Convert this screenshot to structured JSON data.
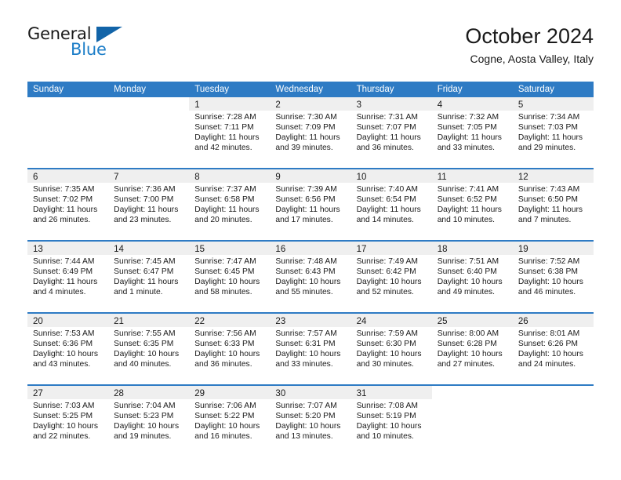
{
  "brand": {
    "name_top": "General",
    "name_bottom": "Blue",
    "triangle_color": "#1264a8",
    "blue_color": "#1d7ec8"
  },
  "header": {
    "title": "October 2024",
    "subtitle": "Cogne, Aosta Valley, Italy"
  },
  "theme": {
    "header_blue": "#2e7bc4",
    "daynum_band": "#efefef",
    "text": "#1a1a1a"
  },
  "weekdays": [
    "Sunday",
    "Monday",
    "Tuesday",
    "Wednesday",
    "Thursday",
    "Friday",
    "Saturday"
  ],
  "weeks": [
    [
      {
        "day": "",
        "sunrise": "",
        "sunset": "",
        "daylight_1": "",
        "daylight_2": ""
      },
      {
        "day": "",
        "sunrise": "",
        "sunset": "",
        "daylight_1": "",
        "daylight_2": ""
      },
      {
        "day": "1",
        "sunrise": "Sunrise: 7:28 AM",
        "sunset": "Sunset: 7:11 PM",
        "daylight_1": "Daylight: 11 hours",
        "daylight_2": "and 42 minutes."
      },
      {
        "day": "2",
        "sunrise": "Sunrise: 7:30 AM",
        "sunset": "Sunset: 7:09 PM",
        "daylight_1": "Daylight: 11 hours",
        "daylight_2": "and 39 minutes."
      },
      {
        "day": "3",
        "sunrise": "Sunrise: 7:31 AM",
        "sunset": "Sunset: 7:07 PM",
        "daylight_1": "Daylight: 11 hours",
        "daylight_2": "and 36 minutes."
      },
      {
        "day": "4",
        "sunrise": "Sunrise: 7:32 AM",
        "sunset": "Sunset: 7:05 PM",
        "daylight_1": "Daylight: 11 hours",
        "daylight_2": "and 33 minutes."
      },
      {
        "day": "5",
        "sunrise": "Sunrise: 7:34 AM",
        "sunset": "Sunset: 7:03 PM",
        "daylight_1": "Daylight: 11 hours",
        "daylight_2": "and 29 minutes."
      }
    ],
    [
      {
        "day": "6",
        "sunrise": "Sunrise: 7:35 AM",
        "sunset": "Sunset: 7:02 PM",
        "daylight_1": "Daylight: 11 hours",
        "daylight_2": "and 26 minutes."
      },
      {
        "day": "7",
        "sunrise": "Sunrise: 7:36 AM",
        "sunset": "Sunset: 7:00 PM",
        "daylight_1": "Daylight: 11 hours",
        "daylight_2": "and 23 minutes."
      },
      {
        "day": "8",
        "sunrise": "Sunrise: 7:37 AM",
        "sunset": "Sunset: 6:58 PM",
        "daylight_1": "Daylight: 11 hours",
        "daylight_2": "and 20 minutes."
      },
      {
        "day": "9",
        "sunrise": "Sunrise: 7:39 AM",
        "sunset": "Sunset: 6:56 PM",
        "daylight_1": "Daylight: 11 hours",
        "daylight_2": "and 17 minutes."
      },
      {
        "day": "10",
        "sunrise": "Sunrise: 7:40 AM",
        "sunset": "Sunset: 6:54 PM",
        "daylight_1": "Daylight: 11 hours",
        "daylight_2": "and 14 minutes."
      },
      {
        "day": "11",
        "sunrise": "Sunrise: 7:41 AM",
        "sunset": "Sunset: 6:52 PM",
        "daylight_1": "Daylight: 11 hours",
        "daylight_2": "and 10 minutes."
      },
      {
        "day": "12",
        "sunrise": "Sunrise: 7:43 AM",
        "sunset": "Sunset: 6:50 PM",
        "daylight_1": "Daylight: 11 hours",
        "daylight_2": "and 7 minutes."
      }
    ],
    [
      {
        "day": "13",
        "sunrise": "Sunrise: 7:44 AM",
        "sunset": "Sunset: 6:49 PM",
        "daylight_1": "Daylight: 11 hours",
        "daylight_2": "and 4 minutes."
      },
      {
        "day": "14",
        "sunrise": "Sunrise: 7:45 AM",
        "sunset": "Sunset: 6:47 PM",
        "daylight_1": "Daylight: 11 hours",
        "daylight_2": "and 1 minute."
      },
      {
        "day": "15",
        "sunrise": "Sunrise: 7:47 AM",
        "sunset": "Sunset: 6:45 PM",
        "daylight_1": "Daylight: 10 hours",
        "daylight_2": "and 58 minutes."
      },
      {
        "day": "16",
        "sunrise": "Sunrise: 7:48 AM",
        "sunset": "Sunset: 6:43 PM",
        "daylight_1": "Daylight: 10 hours",
        "daylight_2": "and 55 minutes."
      },
      {
        "day": "17",
        "sunrise": "Sunrise: 7:49 AM",
        "sunset": "Sunset: 6:42 PM",
        "daylight_1": "Daylight: 10 hours",
        "daylight_2": "and 52 minutes."
      },
      {
        "day": "18",
        "sunrise": "Sunrise: 7:51 AM",
        "sunset": "Sunset: 6:40 PM",
        "daylight_1": "Daylight: 10 hours",
        "daylight_2": "and 49 minutes."
      },
      {
        "day": "19",
        "sunrise": "Sunrise: 7:52 AM",
        "sunset": "Sunset: 6:38 PM",
        "daylight_1": "Daylight: 10 hours",
        "daylight_2": "and 46 minutes."
      }
    ],
    [
      {
        "day": "20",
        "sunrise": "Sunrise: 7:53 AM",
        "sunset": "Sunset: 6:36 PM",
        "daylight_1": "Daylight: 10 hours",
        "daylight_2": "and 43 minutes."
      },
      {
        "day": "21",
        "sunrise": "Sunrise: 7:55 AM",
        "sunset": "Sunset: 6:35 PM",
        "daylight_1": "Daylight: 10 hours",
        "daylight_2": "and 40 minutes."
      },
      {
        "day": "22",
        "sunrise": "Sunrise: 7:56 AM",
        "sunset": "Sunset: 6:33 PM",
        "daylight_1": "Daylight: 10 hours",
        "daylight_2": "and 36 minutes."
      },
      {
        "day": "23",
        "sunrise": "Sunrise: 7:57 AM",
        "sunset": "Sunset: 6:31 PM",
        "daylight_1": "Daylight: 10 hours",
        "daylight_2": "and 33 minutes."
      },
      {
        "day": "24",
        "sunrise": "Sunrise: 7:59 AM",
        "sunset": "Sunset: 6:30 PM",
        "daylight_1": "Daylight: 10 hours",
        "daylight_2": "and 30 minutes."
      },
      {
        "day": "25",
        "sunrise": "Sunrise: 8:00 AM",
        "sunset": "Sunset: 6:28 PM",
        "daylight_1": "Daylight: 10 hours",
        "daylight_2": "and 27 minutes."
      },
      {
        "day": "26",
        "sunrise": "Sunrise: 8:01 AM",
        "sunset": "Sunset: 6:26 PM",
        "daylight_1": "Daylight: 10 hours",
        "daylight_2": "and 24 minutes."
      }
    ],
    [
      {
        "day": "27",
        "sunrise": "Sunrise: 7:03 AM",
        "sunset": "Sunset: 5:25 PM",
        "daylight_1": "Daylight: 10 hours",
        "daylight_2": "and 22 minutes."
      },
      {
        "day": "28",
        "sunrise": "Sunrise: 7:04 AM",
        "sunset": "Sunset: 5:23 PM",
        "daylight_1": "Daylight: 10 hours",
        "daylight_2": "and 19 minutes."
      },
      {
        "day": "29",
        "sunrise": "Sunrise: 7:06 AM",
        "sunset": "Sunset: 5:22 PM",
        "daylight_1": "Daylight: 10 hours",
        "daylight_2": "and 16 minutes."
      },
      {
        "day": "30",
        "sunrise": "Sunrise: 7:07 AM",
        "sunset": "Sunset: 5:20 PM",
        "daylight_1": "Daylight: 10 hours",
        "daylight_2": "and 13 minutes."
      },
      {
        "day": "31",
        "sunrise": "Sunrise: 7:08 AM",
        "sunset": "Sunset: 5:19 PM",
        "daylight_1": "Daylight: 10 hours",
        "daylight_2": "and 10 minutes."
      },
      {
        "day": "",
        "sunrise": "",
        "sunset": "",
        "daylight_1": "",
        "daylight_2": ""
      },
      {
        "day": "",
        "sunrise": "",
        "sunset": "",
        "daylight_1": "",
        "daylight_2": ""
      }
    ]
  ]
}
